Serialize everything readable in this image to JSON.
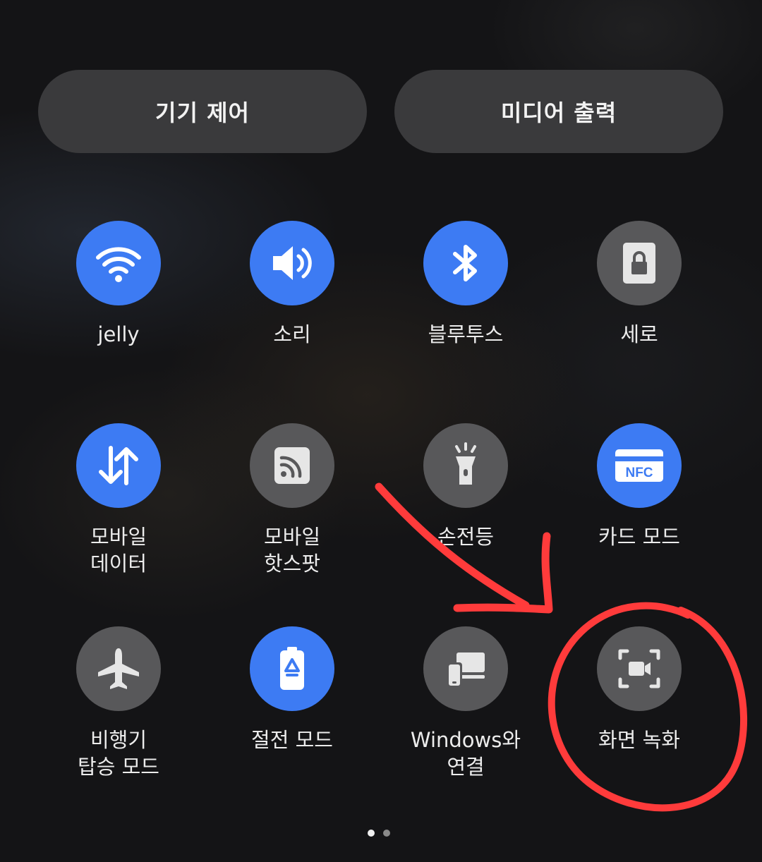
{
  "header": {
    "device_control_label": "기기 제어",
    "media_output_label": "미디어 출력"
  },
  "tiles": [
    {
      "label_line1": "jelly",
      "label_line2": "",
      "icon": "wifi-icon",
      "state": "on"
    },
    {
      "label_line1": "소리",
      "label_line2": "",
      "icon": "speaker-icon",
      "state": "on"
    },
    {
      "label_line1": "블루투스",
      "label_line2": "",
      "icon": "bluetooth-icon",
      "state": "on"
    },
    {
      "label_line1": "세로",
      "label_line2": "",
      "icon": "portrait-lock-icon",
      "state": "off"
    },
    {
      "label_line1": "모바일",
      "label_line2": "데이터",
      "icon": "mobile-data-icon",
      "state": "on"
    },
    {
      "label_line1": "모바일",
      "label_line2": "핫스팟",
      "icon": "hotspot-icon",
      "state": "off"
    },
    {
      "label_line1": "손전등",
      "label_line2": "",
      "icon": "flashlight-icon",
      "state": "off"
    },
    {
      "label_line1": "카드 모드",
      "label_line2": "",
      "icon": "nfc-icon",
      "state": "on"
    },
    {
      "label_line1": "비행기",
      "label_line2": "탑승 모드",
      "icon": "airplane-icon",
      "state": "off"
    },
    {
      "label_line1": "절전 모드",
      "label_line2": "",
      "icon": "battery-saver-icon",
      "state": "on"
    },
    {
      "label_line1": "Windows와",
      "label_line2": "연결",
      "icon": "link-windows-icon",
      "state": "off"
    },
    {
      "label_line1": "화면 녹화",
      "label_line2": "",
      "icon": "screen-record-icon",
      "state": "off"
    }
  ],
  "nfc_icon_text": "NFC",
  "pagination": {
    "total": 2,
    "current": 1
  },
  "colors": {
    "active_tile": "#3d7bf3",
    "inactive_tile": "#58585a",
    "annotation": "#ff3b3b"
  }
}
